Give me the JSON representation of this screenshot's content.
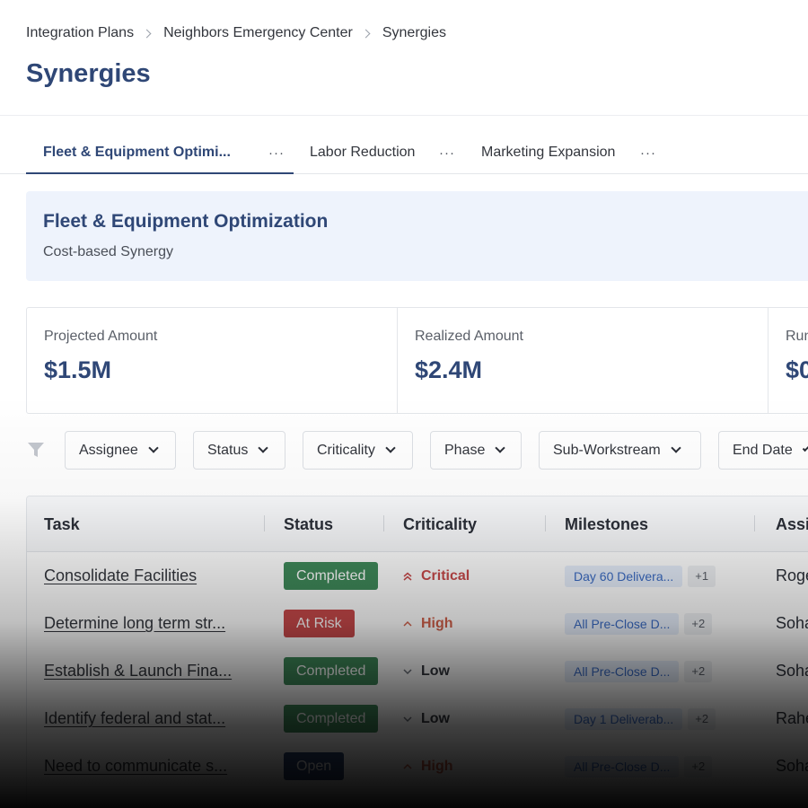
{
  "breadcrumb": [
    "Integration Plans",
    "Neighbors Emergency Center",
    "Synergies"
  ],
  "page_title": "Synergies",
  "tabs": [
    {
      "label": "Fleet & Equipment Optimi...",
      "active": true
    },
    {
      "label": "Labor Reduction",
      "active": false
    },
    {
      "label": "Marketing Expansion",
      "active": false
    }
  ],
  "tab_more": "···",
  "banner": {
    "title": "Fleet & Equipment Optimization",
    "subtitle": "Cost-based Synergy"
  },
  "metrics": [
    {
      "label": "Projected Amount",
      "value": "$1.5M"
    },
    {
      "label": "Realized Amount",
      "value": "$2.4M"
    },
    {
      "label": "Run",
      "value": "$0"
    }
  ],
  "filters": [
    "Assignee",
    "Status",
    "Criticality",
    "Phase",
    "Sub-Workstream",
    "End Date"
  ],
  "table": {
    "headers": [
      "Task",
      "Status",
      "Criticality",
      "Milestones",
      "Assi"
    ],
    "rows": [
      {
        "task": "Consolidate Facilities",
        "status": "Completed",
        "criticality": "Critical",
        "milestone": "Day 60 Delivera...",
        "more": "+1",
        "assignee": "Roge"
      },
      {
        "task": "Determine long term str...",
        "status": "At Risk",
        "criticality": "High",
        "milestone": "All Pre-Close D...",
        "more": "+2",
        "assignee": "Soha"
      },
      {
        "task": "Establish & Launch Fina...",
        "status": "Completed",
        "criticality": "Low",
        "milestone": "All Pre-Close D...",
        "more": "+2",
        "assignee": "Soha"
      },
      {
        "task": "Identify federal and stat...",
        "status": "Completed",
        "criticality": "Low",
        "milestone": "Day 1 Deliverab...",
        "more": "+2",
        "assignee": "Rahe"
      },
      {
        "task": "Need to communicate s...",
        "status": "Open",
        "criticality": "High",
        "milestone": "All Pre-Close D...",
        "more": "+2",
        "assignee": "Soha"
      }
    ]
  },
  "colors": {
    "brand": "#2f4776",
    "completed": "#3f8a5a",
    "at_risk": "#c8494a",
    "open": "#2f4776",
    "critical": "#c8494a",
    "high": "#d0604a",
    "low": "#33363d"
  },
  "icons": {
    "filter": "filter-icon",
    "chevron": "chevron-down-icon",
    "more": "more-horizontal-icon"
  }
}
